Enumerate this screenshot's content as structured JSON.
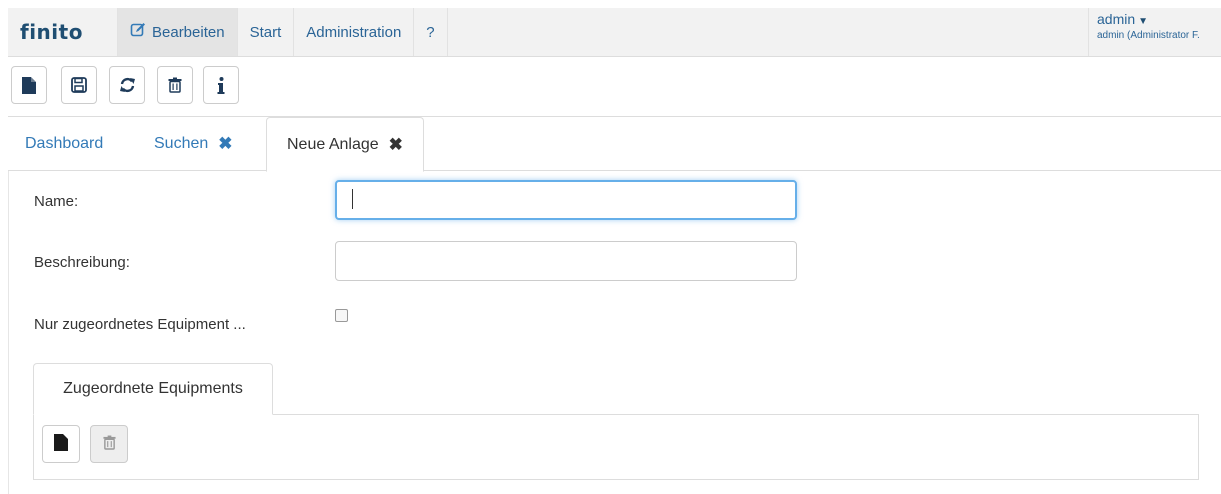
{
  "navbar": {
    "brand": "finito",
    "items": [
      {
        "label": "Bearbeiten",
        "icon": "edit-icon"
      },
      {
        "label": "Start"
      },
      {
        "label": "Administration"
      },
      {
        "label": "?"
      }
    ],
    "user": {
      "name": "admin",
      "subtitle": "admin (Administrator F."
    }
  },
  "toolbar": {
    "buttons": [
      "new-document-icon",
      "save-icon",
      "refresh-icon",
      "trash-icon",
      "info-icon"
    ]
  },
  "tabs": [
    {
      "label": "Dashboard",
      "closable": false
    },
    {
      "label": "Suchen",
      "closable": true,
      "close": "✖"
    },
    {
      "label": "Neue Anlage",
      "closable": true,
      "active": true,
      "close": "✖"
    }
  ],
  "form": {
    "name_label": "Name:",
    "name_value": "",
    "description_label": "Beschreibung:",
    "description_value": "",
    "only_assigned_label": "Nur zugeordnetes Equipment ...",
    "only_assigned_checked": false
  },
  "equipment_panel": {
    "tab_label": "Zugeordnete Equipments",
    "buttons": [
      "new-document-icon",
      "trash-icon"
    ]
  },
  "colors": {
    "link": "#337ab7",
    "brand": "#1f4e72",
    "focus": "#66afe9"
  }
}
